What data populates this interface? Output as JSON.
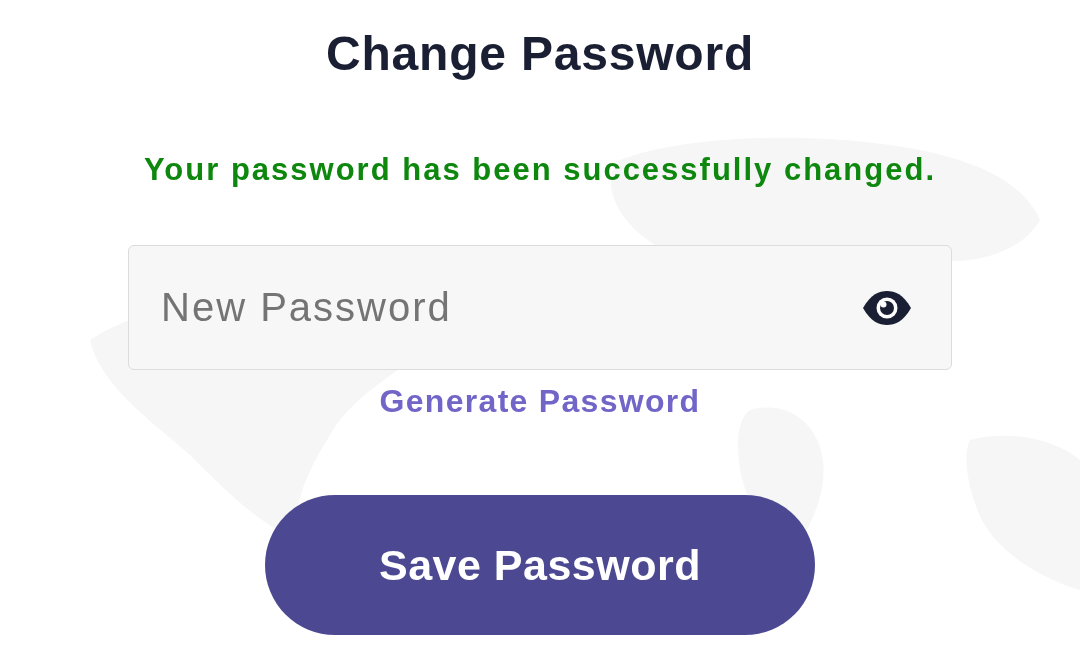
{
  "title": "Change Password",
  "message": {
    "kind": "success",
    "text": "Your password has been successfully changed."
  },
  "password_field": {
    "placeholder": "New Password"
  },
  "generate_link": "Generate Password",
  "submit_button": "Save Password"
}
